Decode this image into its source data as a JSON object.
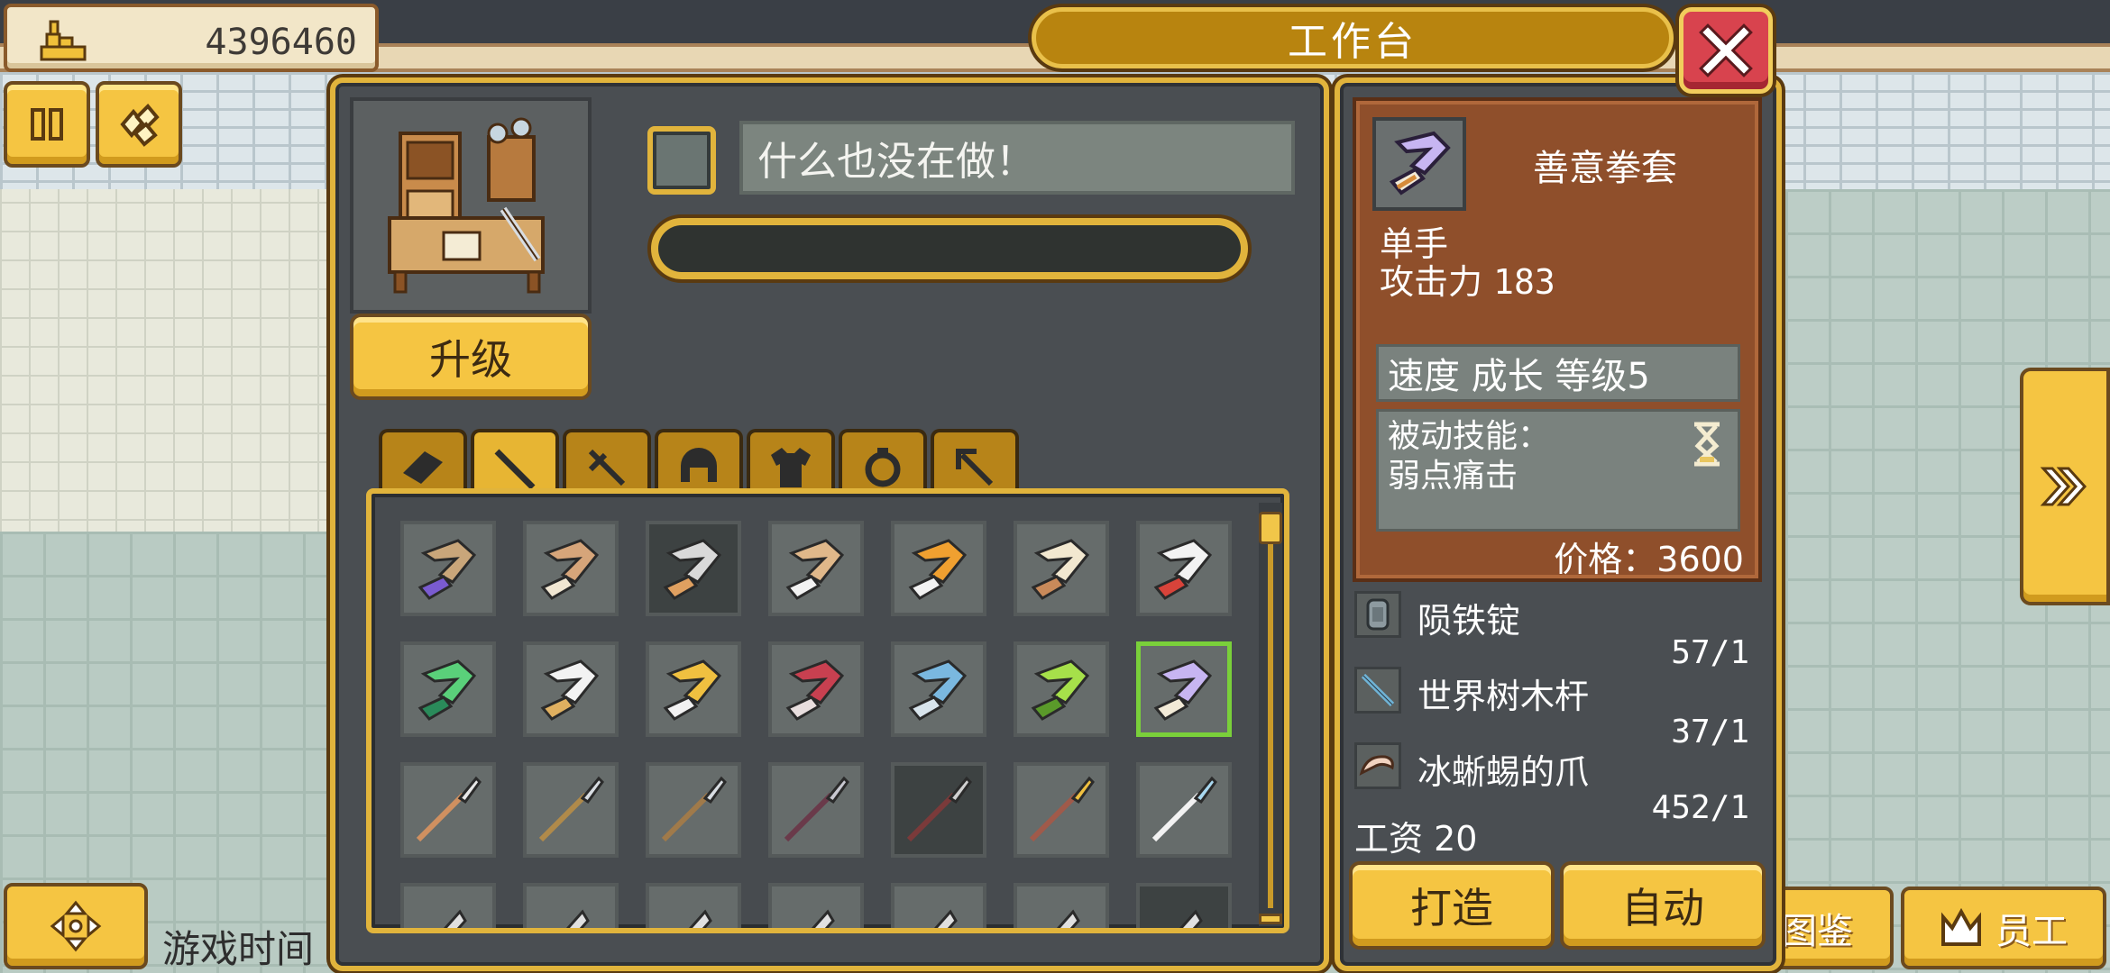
{
  "hud": {
    "gold_amount": "4396460",
    "game_time_label": "游戏时间"
  },
  "workbench": {
    "title": "工作台",
    "status_text": "什么也没在做！",
    "progress_percent": 0,
    "upgrade_label": "升级",
    "tabs": [
      "材料",
      "拳套",
      "剑",
      "头盔",
      "铠甲",
      "饰品",
      "弓"
    ],
    "active_tab_index": 1
  },
  "item_grid": {
    "rows": [
      [
        "staff",
        "bow-claw",
        "claw-gray",
        "knuckle-tan",
        "knuckle-gold",
        "claw-fork",
        "red-blade"
      ],
      [
        "green-knuckle",
        "white-claw",
        "gold-knuckle",
        "red-knuckle",
        "blue-knuckle",
        "lime-knuckle",
        "purple-knuckle"
      ],
      [
        "spear",
        "halberd",
        "shovel",
        "pike",
        "dark-spear",
        "gold-spear",
        "blue-spear"
      ],
      [
        "partial-1",
        "partial-2",
        "partial-3",
        "partial-4",
        "partial-5",
        "partial-6",
        "partial-7"
      ]
    ],
    "selected_item": "purple-knuckle"
  },
  "detail": {
    "name": "善意拳套",
    "hand_type": "单手",
    "attack_label": "攻击力",
    "attack_value": "183",
    "traits": "速度 成长 等级5",
    "passive_label": "被动技能：",
    "passive_skill": "弱点痛击",
    "price_label": "价格：",
    "price_value": "3600"
  },
  "materials": [
    {
      "name": "陨铁锭",
      "count": "57/1",
      "icon": "ingot-icon"
    },
    {
      "name": "世界树木杆",
      "count": "37/1",
      "icon": "wood-pole-icon"
    },
    {
      "name": "冰蜥蜴的爪",
      "count": "452/1",
      "icon": "claw-icon"
    }
  ],
  "wage": {
    "label": "工资",
    "value": "20"
  },
  "actions": {
    "craft_label": "打造",
    "auto_label": "自动"
  },
  "bottom_right": {
    "encyclopedia_label": "图鉴",
    "staff_label": "员工"
  },
  "colors": {
    "gold_button": "#f5c542",
    "panel_bg": "#4a4e52",
    "panel_border": "#e1b43c",
    "detail_bg": "#8f4f2b",
    "close_red": "#d8434e",
    "selected_slot": "#7ad03a"
  }
}
